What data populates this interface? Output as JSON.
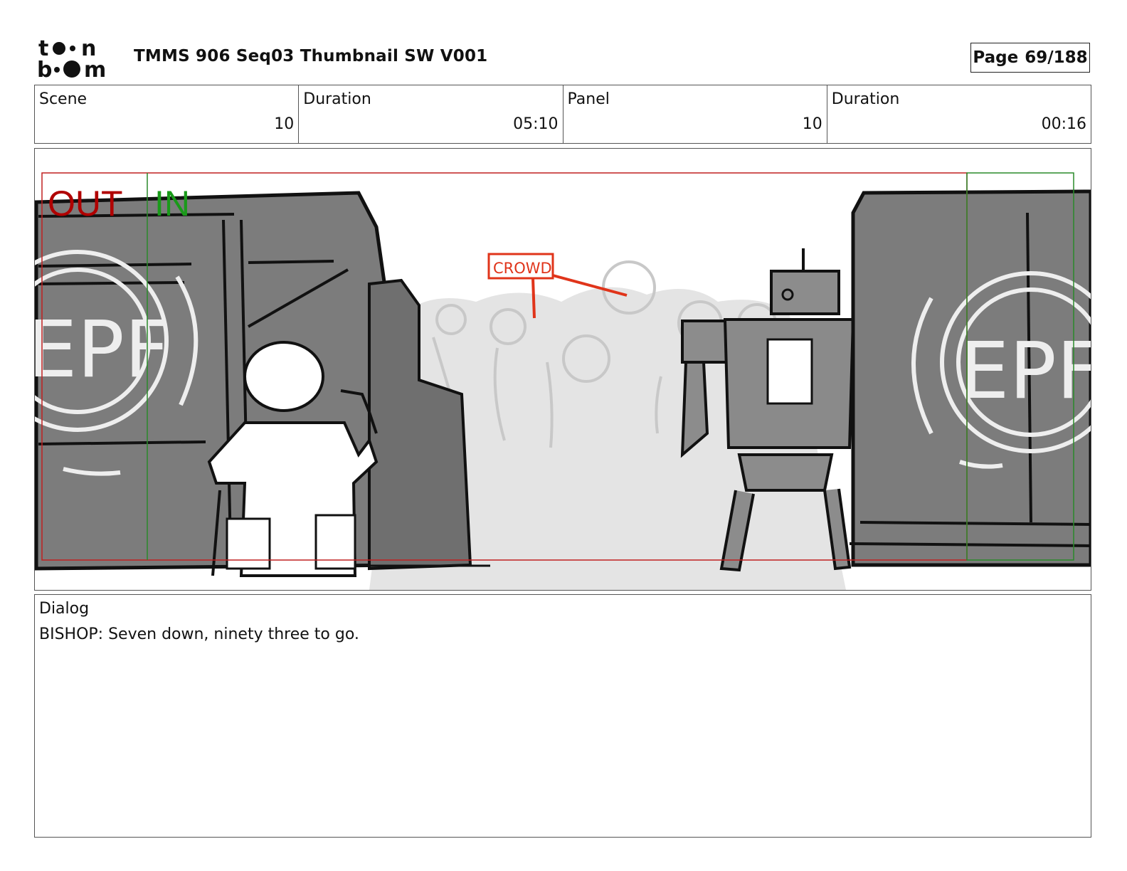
{
  "logo": {
    "icon": "toon-boom-logo",
    "text": "toon boom"
  },
  "document": {
    "title": "TMMS 906 Seq03 Thumbnail SW V001"
  },
  "page": {
    "label": "Page",
    "number": "69/188"
  },
  "info": {
    "scene_label": "Scene",
    "scene_value": "10",
    "scene_duration_label": "Duration",
    "scene_duration_value": "05:10",
    "panel_label": "Panel",
    "panel_value": "10",
    "panel_duration_label": "Duration",
    "panel_duration_value": "00:16"
  },
  "panel": {
    "out_label": "OUT",
    "in_label": "IN",
    "crowd_label": "CROWD",
    "emblem_text": "EPF",
    "colors": {
      "out": "#b00000",
      "in": "#1a9a1a",
      "crowd": "#e0341a",
      "frame_red": "#c02020",
      "frame_green": "#2a8a2a"
    }
  },
  "dialog": {
    "label": "Dialog",
    "text": "BISHOP: Seven down, ninety three to go."
  }
}
